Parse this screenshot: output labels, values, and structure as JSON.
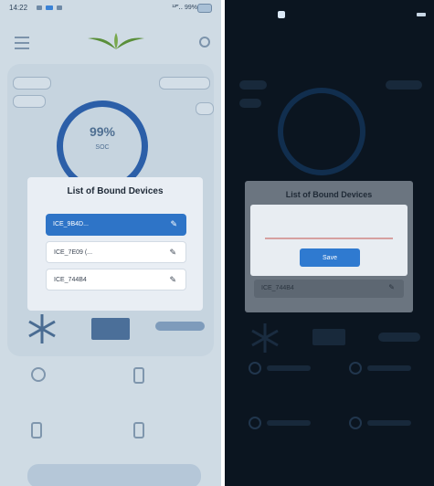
{
  "left_screen": {
    "status": {
      "time": "14:22",
      "right_text": "¹²‴‥ 99%"
    },
    "gauge": {
      "value": "99%",
      "label": "SOC"
    },
    "dialog": {
      "title": "List of Bound Devices",
      "devices": [
        {
          "name": "ICE_9B4D...",
          "selected": true
        },
        {
          "name": "ICE_7E09 (...",
          "selected": false
        },
        {
          "name": "ICE_744B4",
          "selected": false
        }
      ]
    }
  },
  "right_screen": {
    "dialog": {
      "title": "List of Bound Devices",
      "input_value": "",
      "input_placeholder": "",
      "save_label": "Save",
      "behind_device": "ICE_744B4"
    }
  },
  "colors": {
    "accent": "#2e74c7",
    "left_background": "#cfdbe4",
    "right_background": "#0b1520"
  },
  "icons": [
    "menu-icon",
    "logo-icon",
    "settings-icon",
    "edit-icon",
    "snowflake-icon",
    "battery-icon"
  ]
}
